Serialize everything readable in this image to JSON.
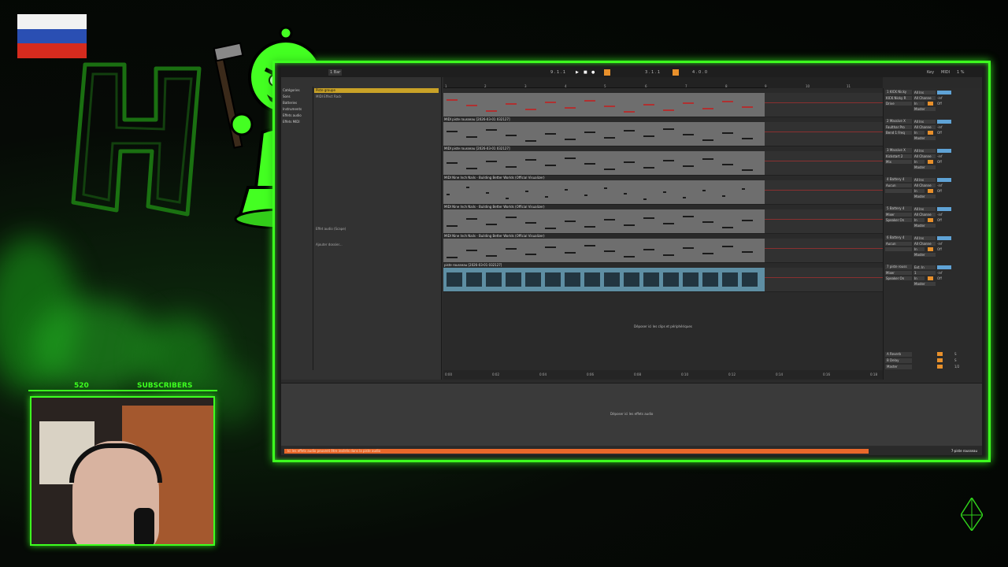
{
  "colors": {
    "neon": "#3dff1f",
    "clip_gray": "#6e6e6e",
    "audio_clip": "#5e8ea3",
    "accent_orange": "#e8902b",
    "accent_blue": "#5fa3d6",
    "status_orange": "#e8682a"
  },
  "overlay": {
    "subscriber_count": "520",
    "subscriber_label": "SUBSCRIBERS",
    "flag_icon": "russia-flag-icon",
    "logo_icon": "green-h-logo-icon",
    "mascot_icon": "green-pawn-mascot-icon"
  },
  "daw": {
    "topbar": {
      "tempo": "1 Bar",
      "position": "9 . 1 . 1",
      "loop_start": "3 . 1 . 1",
      "loop_len": "4 . 0 . 0",
      "key_label": "Key",
      "midi_label": "MIDI",
      "cpu": "1 %"
    },
    "browser": {
      "left_items": [
        "Catégories",
        "Sons",
        "Batteries",
        "Instruments",
        "Effets audio",
        "Effets MIDI"
      ],
      "rows": [
        "Piste groupe",
        "MIDI Effect Rack",
        "Effet audio (Scape)",
        "Ajouter dossier..."
      ],
      "selected_row": 0
    },
    "ruler_ticks": [
      "1",
      "2",
      "3",
      "4",
      "5",
      "6",
      "7",
      "8",
      "9",
      "10",
      "11"
    ],
    "time_ticks": [
      "0:00",
      "0:02",
      "0:04",
      "0:06",
      "0:08",
      "0:10",
      "0:12",
      "0:14",
      "0:16",
      "0:18"
    ],
    "tracks": [
      {
        "clip_name": "",
        "name": "1 KICK Nicky",
        "device": "KICK Nicky R",
        "device2": "Drive",
        "input": "All Ins",
        "channel": "All Channe",
        "out": "Master"
      },
      {
        "clip_name": "MIDI piste rousseau [2026-03-01 032127]",
        "name": "2 Massive X",
        "device": "Faulthar Pro",
        "device2": "Bend 1 Freq",
        "input": "All Ins",
        "channel": "All Channe",
        "out": "Master"
      },
      {
        "clip_name": "MIDI piste rousseau [2026-03-01 032127]",
        "name": "3 Massive X",
        "device": "Kickstart 2",
        "device2": "Mix",
        "input": "All Ins",
        "channel": "All Channe",
        "out": "Master"
      },
      {
        "clip_name": "MIDI Nine Inch Nails - Building Better Worlds (Official Visualizer)",
        "name": "4 Battery 4",
        "device": "Aucun",
        "device2": "",
        "input": "All Ins",
        "channel": "All Channe",
        "out": "Master"
      },
      {
        "clip_name": "MIDI Nine Inch Nails - Building Better Worlds (Official Visualizer)",
        "name": "5 Battery 4",
        "device": "Mixer",
        "device2": "Speaker On",
        "input": "All Ins",
        "channel": "All Channe",
        "out": "Master"
      },
      {
        "clip_name": "MIDI Nine Inch Nails - Building Better Worlds (Official Visualizer)",
        "name": "6 Battery 4",
        "device": "Aucun",
        "device2": "",
        "input": "All Ins",
        "channel": "All Channe",
        "out": "Master"
      },
      {
        "clip_name": "piste rousseau [2026-03-01 032127]",
        "name": "7 piste rouss",
        "device": "Mixer",
        "device2": "Speaker On",
        "input": "Ext. In",
        "channel": "1",
        "out": "Master"
      }
    ],
    "returns": [
      {
        "name": "A Reverb",
        "val": "S"
      },
      {
        "name": "B Delay",
        "val": "S"
      },
      {
        "name": "Master",
        "val": "1/2"
      }
    ],
    "drop_hint_arrangement": "Déposer ici les clips et périphériques",
    "drop_hint_devices": "Déposer ici les effets audio",
    "status_message": "Ici les effets audio peuvent être insérés dans la piste audio",
    "status_track": "7-piste rousseau",
    "inf_label": "-inf",
    "in_label": "In",
    "auto_label": "Auto",
    "off_label": "Off"
  }
}
